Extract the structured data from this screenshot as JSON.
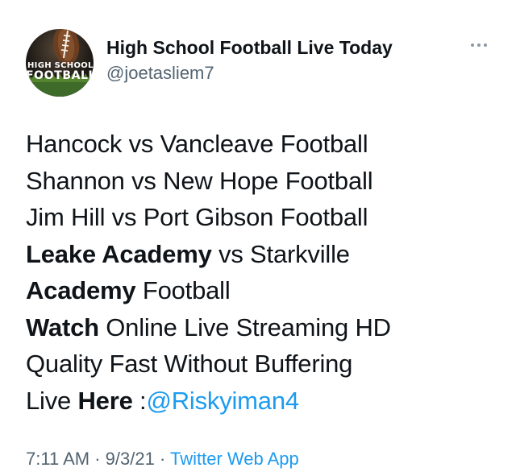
{
  "author": {
    "display_name": "High School Football Live Today",
    "handle": "@joetasliem7",
    "avatar_text_line1": "HIGH SCHOOL",
    "avatar_text_line2": "FOOTBALL"
  },
  "more_icon": "more-horizontal-icon",
  "tweet": {
    "line1": "Hancock vs Vancleave Football",
    "line2": "Shannon vs New Hope Football",
    "line3": "Jim Hill vs Port Gibson Football",
    "line4_bold": "Leake Academy",
    "line4_rest": " vs Starkville",
    "line5_bold": "Academy",
    "line5_rest": " Football",
    "line6_bold": "Watch",
    "line6_rest": " Online Live Streaming HD",
    "line7": "Quality Fast Without Buffering",
    "line8_prefix": "Live ",
    "line8_bold": "Here",
    "line8_colon": " :",
    "mention": "@Riskyiman4"
  },
  "meta": {
    "time": "7:11 AM",
    "sep1": " · ",
    "date": "9/3/21",
    "sep2": " · ",
    "source": "Twitter Web App"
  },
  "colors": {
    "text": "#0f1419",
    "secondary": "#536471",
    "link": "#1d9bf0"
  }
}
